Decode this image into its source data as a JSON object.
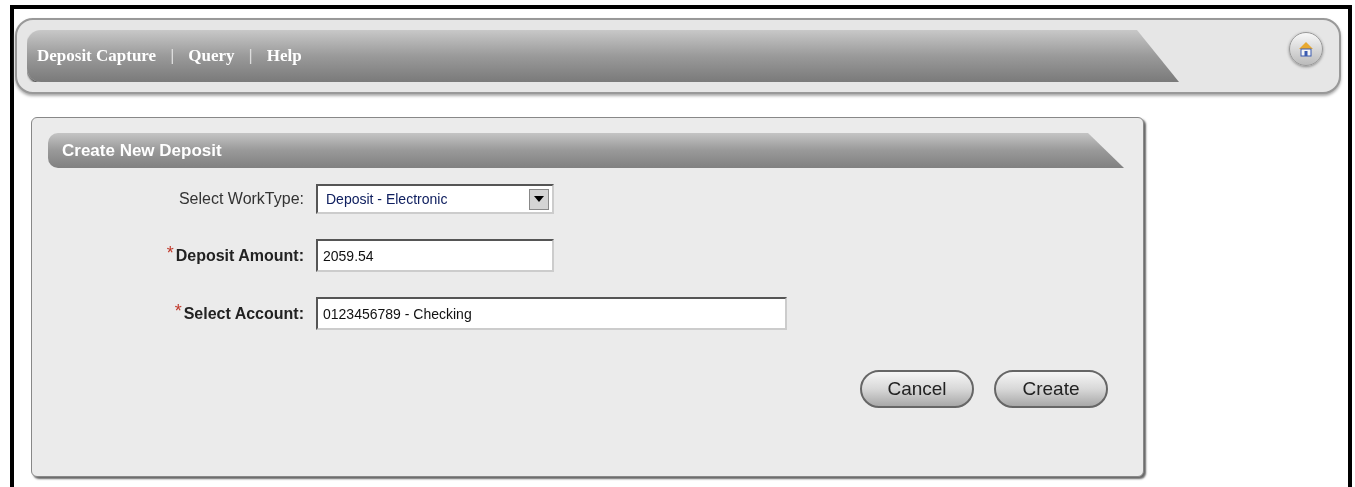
{
  "nav": {
    "items": [
      {
        "label": "Deposit Capture"
      },
      {
        "label": "Query"
      },
      {
        "label": "Help"
      }
    ],
    "separator": "|"
  },
  "panel": {
    "title": "Create New Deposit",
    "fields": [
      {
        "kind": "select",
        "label": "Select WorkType:",
        "required": false,
        "value": "Deposit - Electronic"
      },
      {
        "kind": "input",
        "label": "Deposit Amount:",
        "required": true,
        "value": "2059.54"
      },
      {
        "kind": "wide-input",
        "label": "Select Account:",
        "required": true,
        "value": "0123456789 - Checking"
      }
    ],
    "required_mark": "*",
    "buttons": [
      {
        "label": "Cancel"
      },
      {
        "label": "Create"
      }
    ]
  }
}
